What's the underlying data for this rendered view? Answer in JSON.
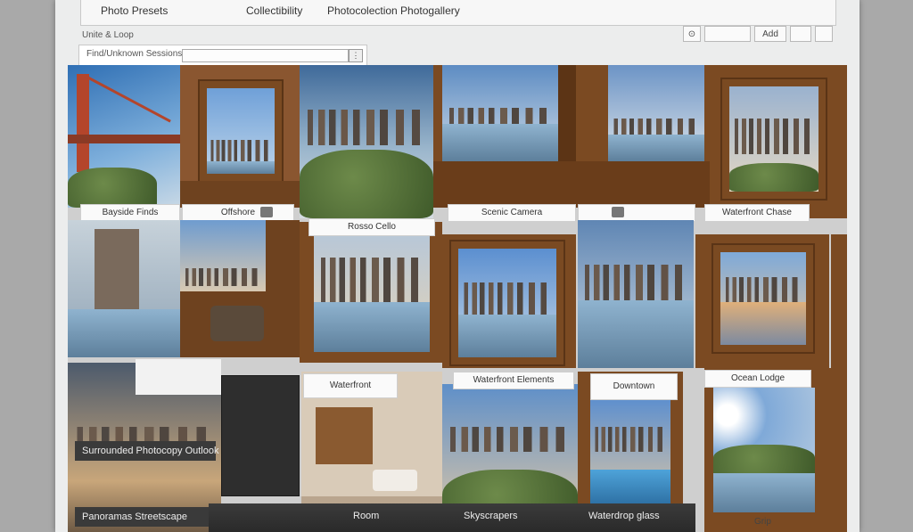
{
  "header": {
    "items": [
      "Photo Presets",
      "Collectibility",
      "Photocolection Photogallery"
    ]
  },
  "subheader": {
    "label": "Unite & Loop"
  },
  "search": {
    "label": "Find/Unknown Sessions",
    "button_label": "⋮"
  },
  "toolbar": {
    "labels": [
      "⊙",
      "",
      "Add",
      "",
      ""
    ]
  },
  "captions": {
    "row1_a": "Bayside Finds",
    "row1_b": "Offshore",
    "row1_c": "Scenic Camera",
    "row1_d": "",
    "row1_e": "Waterfront Chase",
    "row2_mid": "Rosso Cello",
    "row3_a": "Waterfront",
    "row3_b": "Waterfront Elements",
    "row3_c": "Downtown",
    "row3_d": "Ocean Lodge",
    "dark1": "Surrounded Photocopy Outlook",
    "dark2": "Panoramas Streetscape"
  },
  "bottom_bar": {
    "labels": [
      "Room",
      "Skyscrapers",
      "Waterdrop glass"
    ]
  },
  "footer": {
    "label": "Grip"
  }
}
